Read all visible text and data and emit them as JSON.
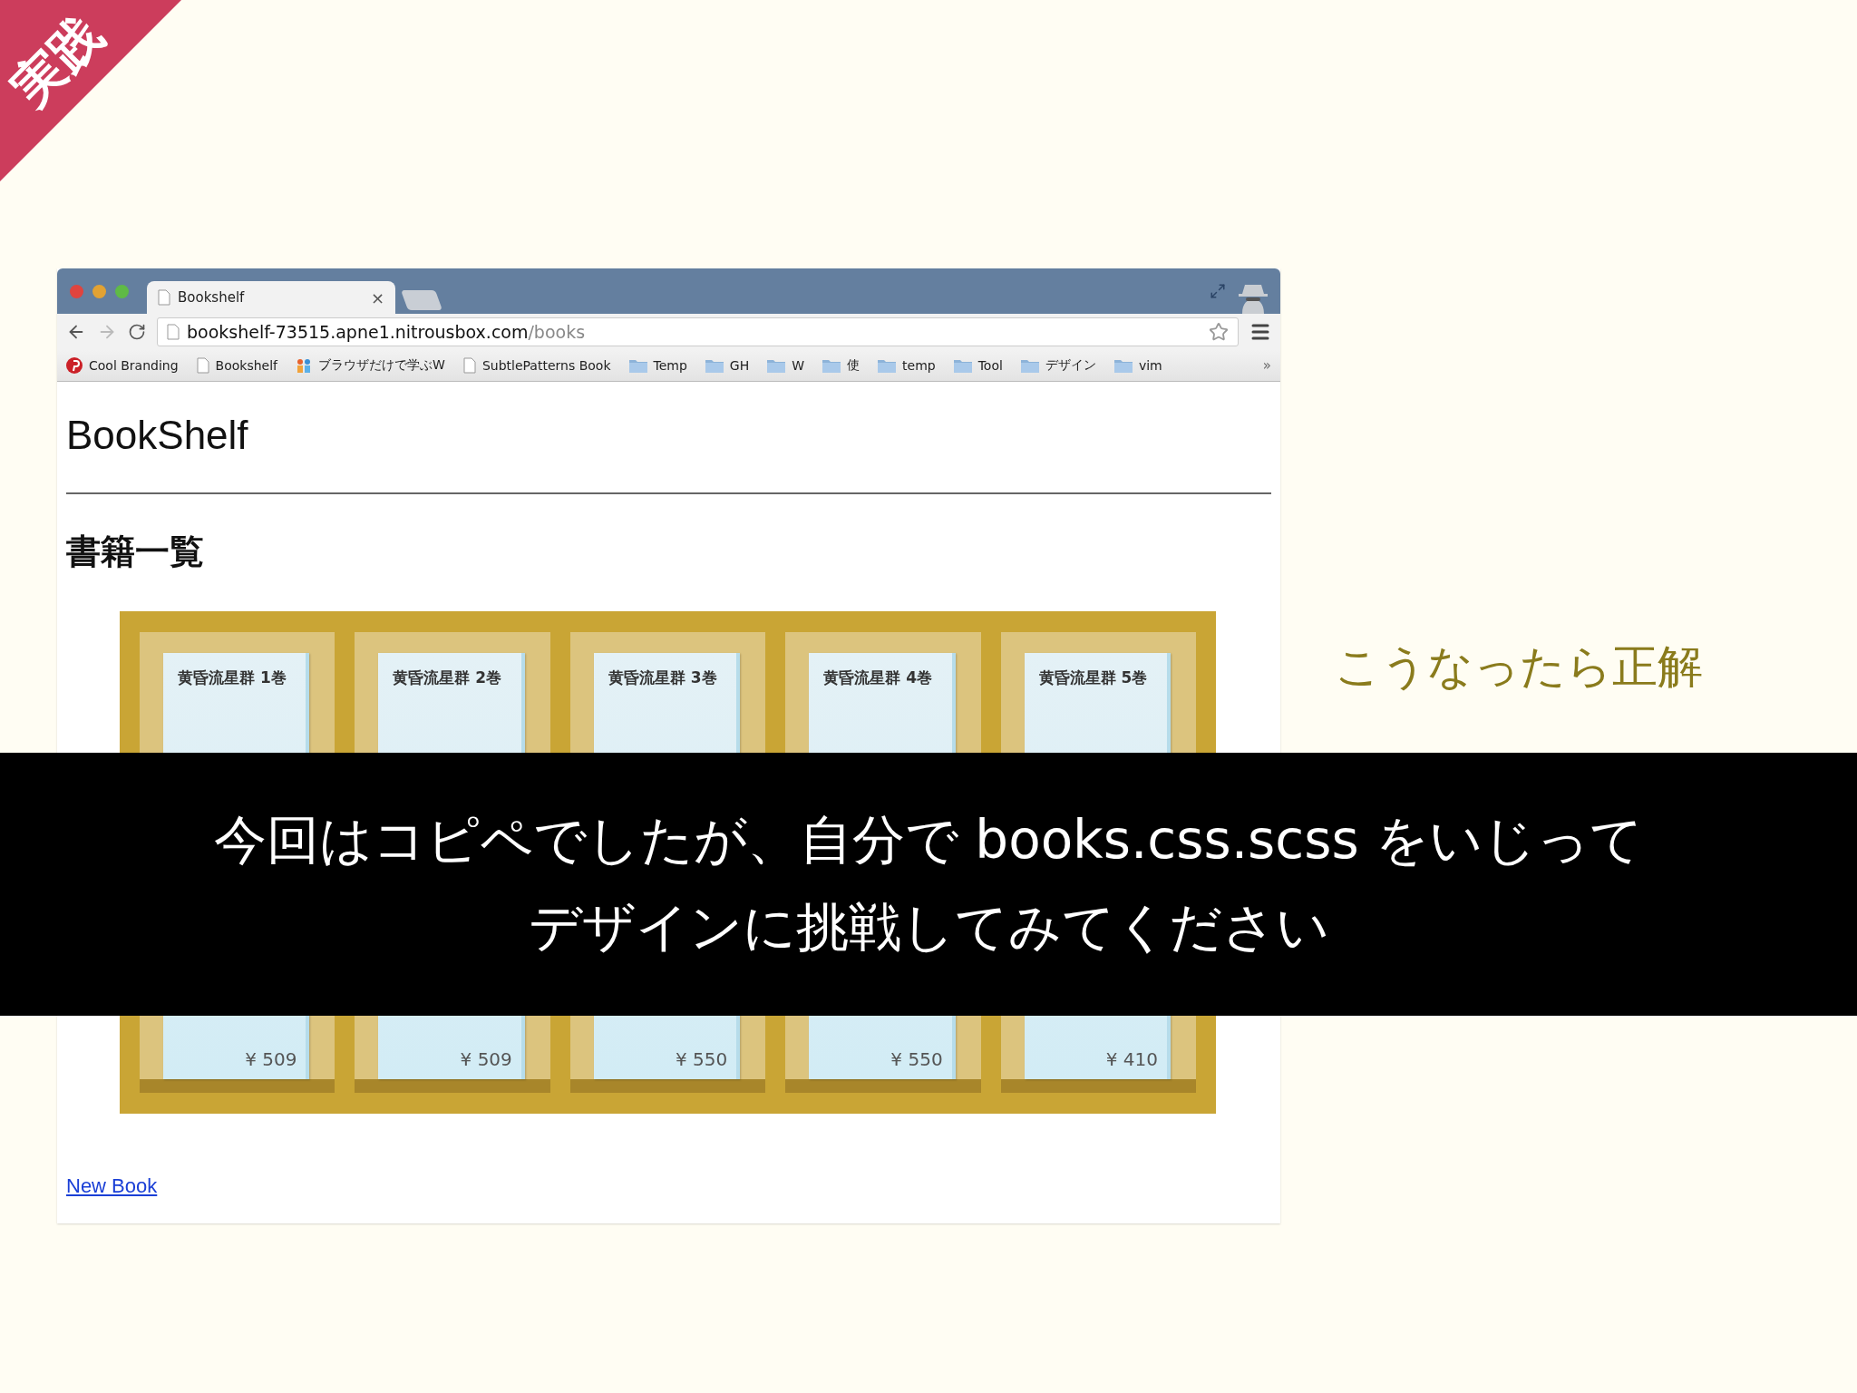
{
  "corner_badge": "実践",
  "browser": {
    "tab": {
      "title": "Bookshelf",
      "close": "×"
    },
    "address": {
      "host": "bookshelf-73515.apne1.nitrousbox.com",
      "path": "/books"
    },
    "bookmarks": [
      {
        "kind": "pinterest",
        "label": "Cool Branding"
      },
      {
        "kind": "page",
        "label": "Bookshelf"
      },
      {
        "kind": "app",
        "label": "ブラウザだけで学ぶW"
      },
      {
        "kind": "page",
        "label": "SubtlePatterns Book"
      },
      {
        "kind": "folder",
        "label": "Temp"
      },
      {
        "kind": "folder",
        "label": "GH"
      },
      {
        "kind": "folder",
        "label": "W"
      },
      {
        "kind": "folder",
        "label": "使"
      },
      {
        "kind": "folder",
        "label": "temp"
      },
      {
        "kind": "folder",
        "label": "Tool"
      },
      {
        "kind": "folder",
        "label": "デザイン"
      },
      {
        "kind": "folder",
        "label": "vim"
      }
    ],
    "more": "»"
  },
  "page": {
    "title": "BookShelf",
    "section": "書籍一覧",
    "books": [
      {
        "title": "黄昏流星群 1巻",
        "price": "¥ 509"
      },
      {
        "title": "黄昏流星群 2巻",
        "price": "¥ 509"
      },
      {
        "title": "黄昏流星群 3巻",
        "price": "¥ 550"
      },
      {
        "title": "黄昏流星群 4巻",
        "price": "¥ 550"
      },
      {
        "title": "黄昏流星群 5巻",
        "price": "¥ 410"
      }
    ],
    "link": "New Book"
  },
  "side_note": "こうなったら正解",
  "caption": [
    "今回はコピペでしたが、自分で books.css.scss をいじって",
    "デザインに挑戦してみてください"
  ]
}
